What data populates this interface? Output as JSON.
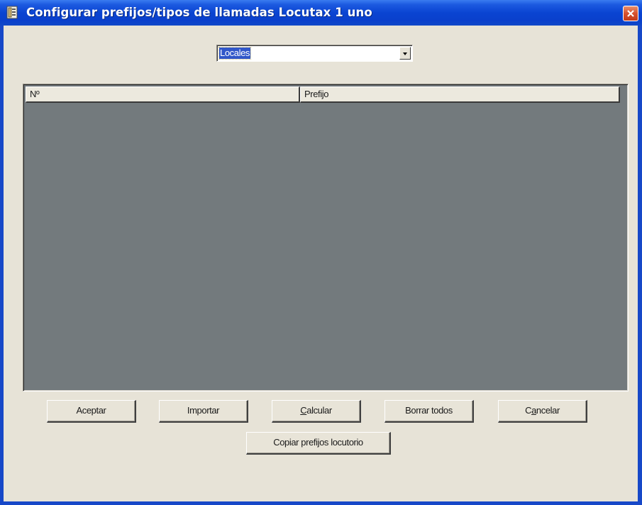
{
  "window": {
    "title": "Configurar prefijos/tipos de llamadas Locutax 1 uno",
    "icon": "app-icon",
    "close_icon": "close-icon"
  },
  "combo": {
    "selected": "Locales",
    "arrow_icon": "chevron-down-icon"
  },
  "listview": {
    "columns": [
      {
        "label": "Nº"
      },
      {
        "label": "Prefijo"
      }
    ],
    "rows": []
  },
  "buttons": {
    "aceptar": {
      "label": "Aceptar"
    },
    "importar": {
      "label": "Importar"
    },
    "calcular": {
      "first": "C",
      "rest": "alcular"
    },
    "borrar_todos": {
      "label": "Borrar todos"
    },
    "cancelar": {
      "pre": "C",
      "ul": "a",
      "post": "ncelar"
    },
    "copiar": {
      "label": "Copiar prefijos locutorio"
    }
  },
  "colors": {
    "title_bar": "#0a44d2",
    "dialog_bg": "#e7e3d7",
    "list_bg": "#737a7d",
    "selection": "#3157c9"
  }
}
